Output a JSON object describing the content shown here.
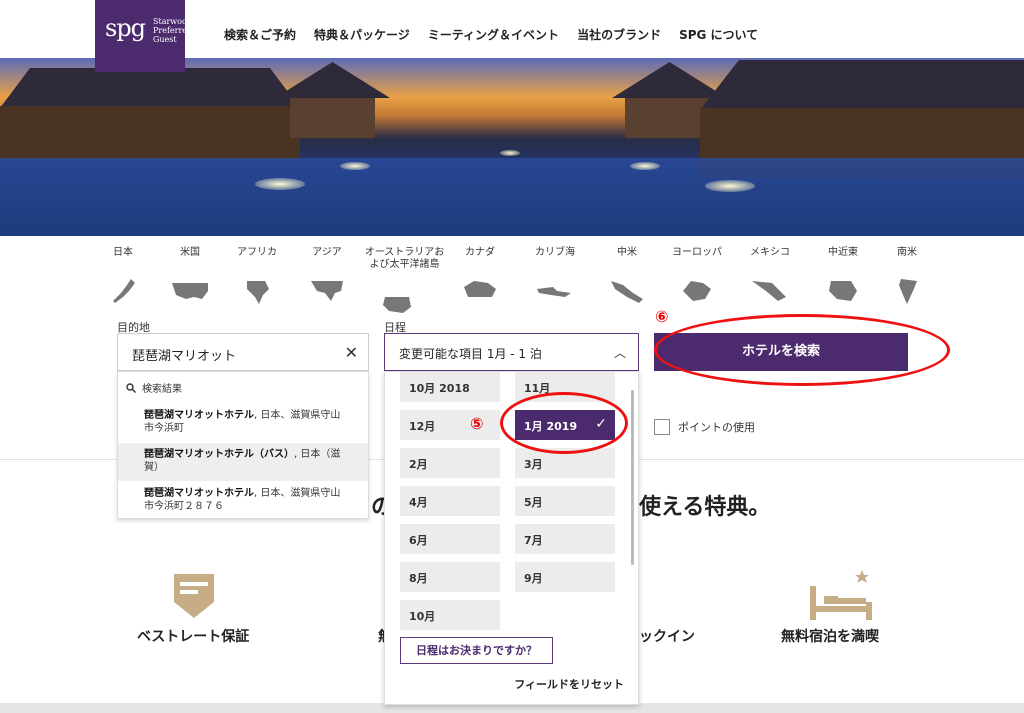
{
  "header": {
    "logo_mark": "spg",
    "logo_line1": "Starwood",
    "logo_line2": "Preferred",
    "logo_line3": "Guest",
    "nav": [
      "検索＆ご予約",
      "特典＆パッケージ",
      "ミーティング＆イベント",
      "当社のブランド",
      "SPG について"
    ]
  },
  "regions": [
    "日本",
    "米国",
    "アフリカ",
    "アジア",
    "オーストラリアおよび太平洋諸島",
    "カナダ",
    "カリブ海",
    "中米",
    "ヨーロッパ",
    "メキシコ",
    "中近東",
    "南米"
  ],
  "search": {
    "destination_label": "目的地",
    "destination_value": "琵琶湖マリオット",
    "suggest_header": "検索結果",
    "suggestions": [
      {
        "bold": "琵琶湖マリオットホテル",
        "rest": ", 日本、滋賀県守山市今浜町"
      },
      {
        "bold": "琵琶湖マリオットホテル（バス）",
        "rest": ", 日本（滋賀）"
      },
      {
        "bold": "琵琶湖マリオットホテル",
        "rest": ", 日本、滋賀県守山市今浜町２８７６"
      }
    ],
    "date_label": "日程",
    "date_value": "変更可能な項目 1月 - 1 泊",
    "months": [
      {
        "label": "10月 2018",
        "selected": false
      },
      {
        "label": "11月",
        "selected": false
      },
      {
        "label": "12月",
        "selected": false
      },
      {
        "label": "1月 2019",
        "selected": true
      },
      {
        "label": "2月",
        "selected": false
      },
      {
        "label": "3月",
        "selected": false
      },
      {
        "label": "4月",
        "selected": false
      },
      {
        "label": "5月",
        "selected": false
      },
      {
        "label": "6月",
        "selected": false
      },
      {
        "label": "7月",
        "selected": false
      },
      {
        "label": "8月",
        "selected": false
      },
      {
        "label": "9月",
        "selected": false
      },
      {
        "label": "10月",
        "selected": false
      }
    ],
    "undecided_button": "日程はお決まりですか？",
    "reset_link": "フィールドをリセット",
    "search_button": "ホテルを検索",
    "points_label": "ポイントの使用"
  },
  "section": {
    "heading_left": "の",
    "heading_right": "使える特典。"
  },
  "benefits": [
    "ベストレート保証",
    "無",
    "ックイン",
    "無料宿泊を満喫"
  ],
  "annotations": {
    "five": "⑤",
    "six": "⑥"
  },
  "colors": {
    "brand_purple": "#4b2a6e",
    "annotation_red": "#e11111",
    "benefit_gold": "#c7ad85"
  }
}
